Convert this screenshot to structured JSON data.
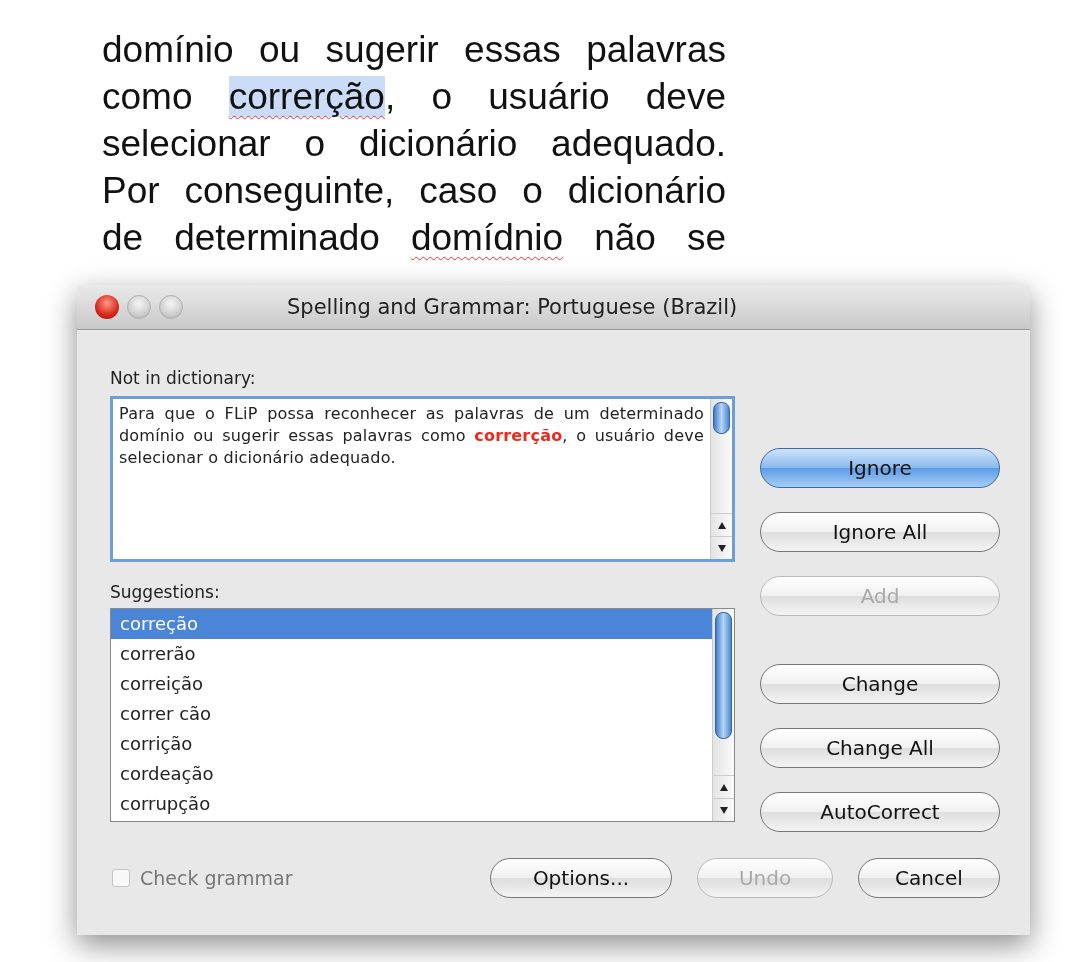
{
  "document": {
    "lines": [
      [
        {
          "text": "domínio ou sugerir essas palavras",
          "misspelled": false,
          "highlighted": false
        }
      ],
      [
        {
          "text": "como ",
          "misspelled": false,
          "highlighted": false
        },
        {
          "text": "correrção",
          "misspelled": true,
          "highlighted": true
        },
        {
          "text": ", o usuário deve",
          "misspelled": false,
          "highlighted": false
        }
      ],
      [
        {
          "text": "selecionar o dicionário adequado.",
          "misspelled": false,
          "highlighted": false
        }
      ],
      [
        {
          "text": "Por conseguinte, caso o dicionário",
          "misspelled": false,
          "highlighted": false
        }
      ],
      [
        {
          "text": "de determinado ",
          "misspelled": false,
          "highlighted": false
        },
        {
          "text": "domídnio",
          "misspelled": true,
          "highlighted": false
        },
        {
          "text": " não se",
          "misspelled": false,
          "highlighted": false
        }
      ]
    ]
  },
  "dialog": {
    "title": "Spelling and Grammar: Portuguese (Brazil)",
    "not_in_dictionary": {
      "label": "Not in dictionary:",
      "text": "Para que o FLiP possa reconhecer as palavras de um determinado domínio ou sugerir essas palavras como **correrção**, o usuário deve selecionar o dicionário adequado."
    },
    "suggestions": {
      "label": "Suggestions:",
      "items": [
        {
          "text": "correção",
          "selected": true
        },
        {
          "text": "correrão",
          "selected": false
        },
        {
          "text": "correição",
          "selected": false
        },
        {
          "text": "correr cão",
          "selected": false
        },
        {
          "text": "corrição",
          "selected": false
        },
        {
          "text": "cordeação",
          "selected": false
        },
        {
          "text": "corrupção",
          "selected": false
        }
      ]
    },
    "side_buttons": [
      {
        "label": "Ignore",
        "default": true,
        "disabled": false
      },
      {
        "label": "Ignore All",
        "default": false,
        "disabled": false
      },
      {
        "label": "Add",
        "default": false,
        "disabled": true
      },
      {
        "label": "Change",
        "default": false,
        "disabled": false
      },
      {
        "label": "Change All",
        "default": false,
        "disabled": false
      },
      {
        "label": "AutoCorrect",
        "default": false,
        "disabled": false
      }
    ],
    "check_grammar": {
      "label": "Check grammar",
      "checked": false,
      "disabled": true
    },
    "bottom_buttons": [
      {
        "label": "Options...",
        "default": false,
        "disabled": false
      },
      {
        "label": "Undo",
        "default": false,
        "disabled": true
      },
      {
        "label": "Cancel",
        "default": false,
        "disabled": false
      }
    ]
  }
}
